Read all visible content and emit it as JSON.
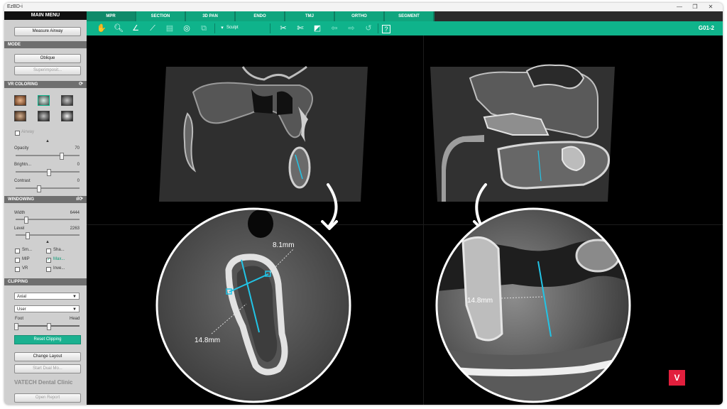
{
  "window": {
    "title": "EzBD-i"
  },
  "sidebar": {
    "header": "MAIN MENU",
    "measure_airway": "Measure Airway",
    "mode_title": "MODE",
    "oblique": "Oblique",
    "superimpose": "Superimposit...",
    "vr_coloring_title": "VR COLORING",
    "airway": "Airway",
    "opacity_label": "Opacity",
    "opacity_value": "70",
    "brightness_label": "Brightn...",
    "brightness_value": "0",
    "contrast_label": "Contrast",
    "contrast_value": "0",
    "windowing_title": "WINDOWING",
    "width_label": "Width",
    "width_value": "6444",
    "level_label": "Level",
    "level_value": "2263",
    "options": [
      {
        "label": "Sm...",
        "checked": false
      },
      {
        "label": "Sha...",
        "checked": false
      },
      {
        "label": "MIP",
        "checked": false
      },
      {
        "label": "Max...",
        "checked": true
      },
      {
        "label": "VR",
        "checked": false
      },
      {
        "label": "Inve...",
        "checked": false
      }
    ],
    "clipping_title": "CLIPPING",
    "clip_view": "Axial",
    "clip_mode": "User",
    "foot_label": "Foot",
    "head_label": "Head",
    "reset_clipping": "Reset Clipping",
    "change_layout": "Change Layout",
    "start_dual": "Start Dual Mo...",
    "clinic": "VATECH Dental Clinic",
    "open_report": "Open Report"
  },
  "tabs": [
    "MPR",
    "SECTION",
    "3D PAN",
    "ENDO",
    "TMJ",
    "ORTHO",
    "SEGMENT"
  ],
  "active_tab": "MPR",
  "toolbar": {
    "sculpt": "Sculpt",
    "case_id": "G01-2"
  },
  "measurements": {
    "width": "8.1mm",
    "height_left": "14.8mm",
    "height_right": "14.8mm"
  },
  "badge": "V",
  "colors": {
    "accent": "#0fb38b",
    "tab_active": "#0f8a6a",
    "measure": "#22c4e6",
    "badge": "#e21f3d"
  }
}
